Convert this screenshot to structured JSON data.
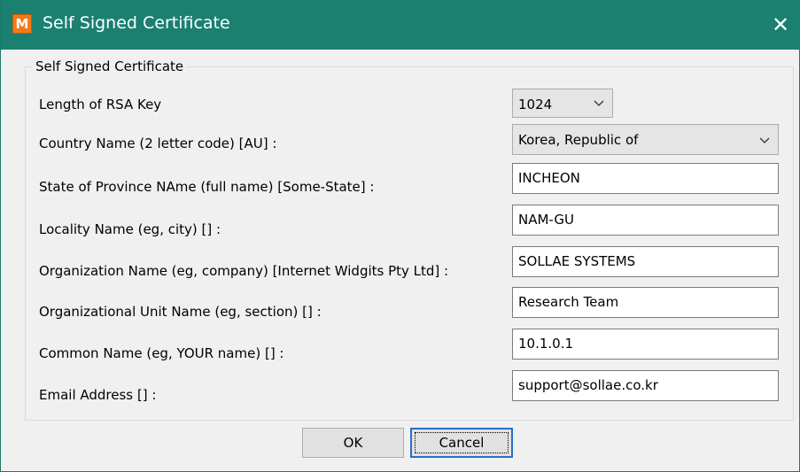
{
  "window": {
    "title": "Self Signed Certificate",
    "app_icon_letter": "M",
    "close_glyph": "✕"
  },
  "group": {
    "title": "Self Signed Certificate"
  },
  "fields": {
    "rsa_key_length": {
      "label": "Length of RSA Key",
      "value": "1024"
    },
    "country": {
      "label": "Country Name (2 letter code) [AU] :",
      "value": "Korea, Republic of"
    },
    "state": {
      "label": "State of Province NAme (full name) [Some-State] :",
      "value": "INCHEON"
    },
    "locality": {
      "label": "Locality Name (eg, city) [] :",
      "value": "NAM-GU"
    },
    "organization": {
      "label": "Organization Name (eg, company) [Internet Widgits Pty Ltd] :",
      "value": "SOLLAE SYSTEMS"
    },
    "org_unit": {
      "label": "Organizational Unit Name (eg, section) [] :",
      "value": "Research Team"
    },
    "common_name": {
      "label": "Common Name (eg, YOUR name) [] :",
      "value": "10.1.0.1"
    },
    "email": {
      "label": "Email Address [] :",
      "value": "support@sollae.co.kr"
    }
  },
  "buttons": {
    "ok": "OK",
    "cancel": "Cancel"
  },
  "icons": {
    "app": "app-logo-icon",
    "close": "close-icon",
    "dropdown": "chevron-down-icon"
  },
  "colors": {
    "titlebar": "#1b8070",
    "app_icon": "#f07a1a",
    "default_button_border": "#2a6fc9"
  }
}
